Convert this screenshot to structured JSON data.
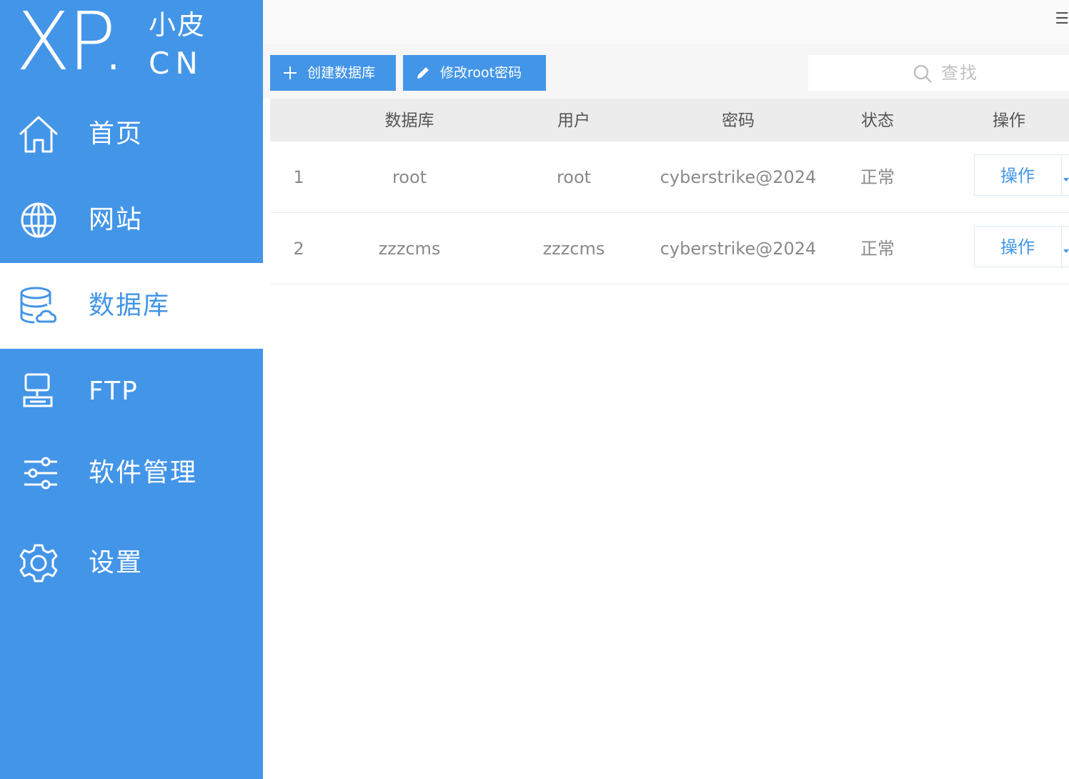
{
  "logo": {
    "main": "XP.",
    "cn_top": "小皮",
    "cn_bottom": "CN"
  },
  "sidebar": {
    "items": [
      {
        "label": "首页",
        "icon": "home-icon",
        "active": false
      },
      {
        "label": "网站",
        "icon": "globe-icon",
        "active": false
      },
      {
        "label": "数据库",
        "icon": "database-icon",
        "active": true
      },
      {
        "label": "FTP",
        "icon": "server-icon",
        "active": false
      },
      {
        "label": "软件管理",
        "icon": "sliders-icon",
        "active": false
      },
      {
        "label": "设置",
        "icon": "gear-icon",
        "active": false
      }
    ]
  },
  "topbar": {
    "menu_glyph": "☰"
  },
  "toolbar": {
    "create_label": "创建数据库",
    "change_pwd_label": "修改root密码",
    "search_placeholder": "查找"
  },
  "table": {
    "headers": [
      "",
      "数据库",
      "用户",
      "密码",
      "状态",
      "操作"
    ],
    "rows": [
      {
        "index": "1",
        "database": "root",
        "user": "root",
        "password": "cyberstrike@2024",
        "status": "正常",
        "action": "操作"
      },
      {
        "index": "2",
        "database": "zzzcms",
        "user": "zzzcms",
        "password": "cyberstrike@2024",
        "status": "正常",
        "action": "操作"
      }
    ]
  },
  "colors": {
    "accent": "#4395e8",
    "sidebar_bg": "#4395e8",
    "header_bg": "#ececec",
    "text_muted": "#8a8a8a"
  }
}
